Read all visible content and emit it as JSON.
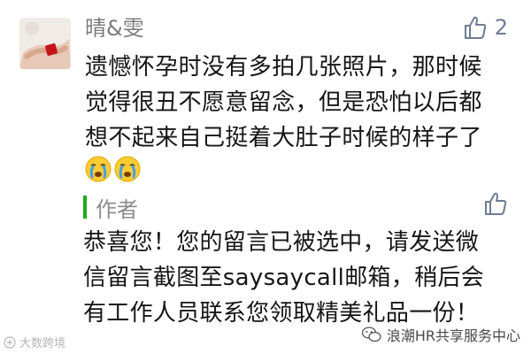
{
  "comment": {
    "username": "晴&雯",
    "like_count": "2",
    "lines": [
      "遗憾怀孕时没有多拍几张照片，那时候",
      "觉得很丑不愿意留念，但是恐怕以后都",
      "想不起来自己挺着大肚子时候的样子了"
    ],
    "emojis": [
      "crying-face-icon",
      "crying-face-icon"
    ]
  },
  "reply": {
    "author_label": "作者",
    "lines": [
      "恭喜您！您的留言已被选中，请发送微",
      "信留言截图至saysaycall邮箱，稍后会",
      "有工作人员联系您领取精美礼品一份！"
    ]
  },
  "watermarks": {
    "left": "大数跨境",
    "right": "浪潮HR共享服务中心"
  },
  "colors": {
    "accent_green": "#1aad19",
    "like_icon": "#6e7c93",
    "username": "#7a7a7a"
  }
}
